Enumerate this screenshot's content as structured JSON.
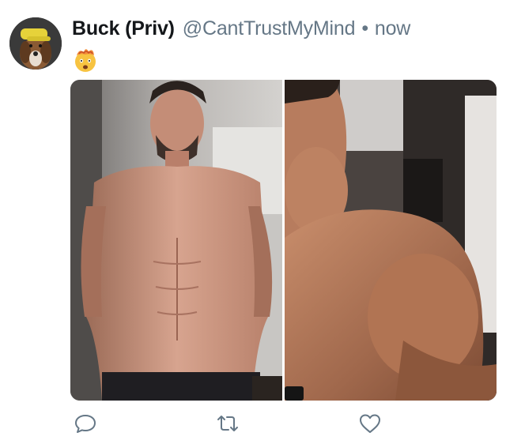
{
  "tweet": {
    "display_name": "Buck (Priv)",
    "handle": "@CantTrustMyMind",
    "separator": "•",
    "timestamp": "now",
    "emoji": "exploding-head-emoji"
  },
  "media": {
    "left_photo": "before-photo",
    "right_photo": "after-photo"
  },
  "actions": {
    "reply_icon": "reply-icon",
    "retweet_icon": "retweet-icon",
    "like_icon": "heart-icon"
  },
  "colors": {
    "name": "#14171a",
    "secondary": "#657786",
    "icon": "#657786",
    "background": "#ffffff"
  }
}
